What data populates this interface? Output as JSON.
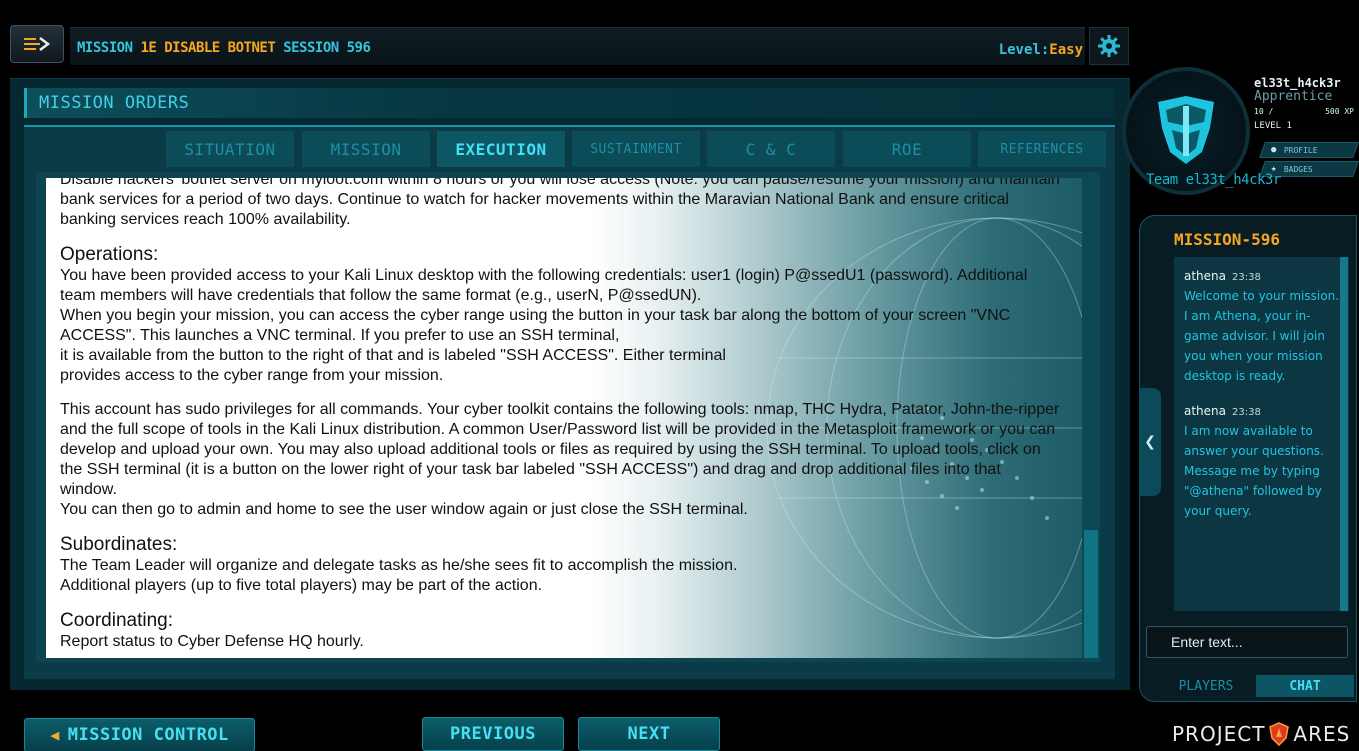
{
  "header": {
    "mission_prefix": "MISSION",
    "mission_id": "1E DISABLE BOTNET",
    "session_label": "SESSION 596",
    "level_label": "Level:",
    "level_value": "Easy"
  },
  "orders": {
    "title": "MISSION ORDERS",
    "tabs": [
      {
        "label": "SITUATION",
        "active": false
      },
      {
        "label": "MISSION",
        "active": false
      },
      {
        "label": "EXECUTION",
        "active": true
      },
      {
        "label": "SUSTAINMENT",
        "active": false
      },
      {
        "label": "C & C",
        "active": false
      },
      {
        "label": "ROE",
        "active": false
      },
      {
        "label": "REFERENCES",
        "active": false
      }
    ],
    "intro": "Disable hackers' botnet server on myloot.com within 8 hours or you will lose access (Note: you can pause/resume your mission) and maintain bank services for a period of two days.  Continue to watch for hacker movements within the Maravian National Bank and ensure critical banking services reach 100% availability.",
    "operations_heading": "Operations:",
    "operations_p1": "You have been provided access to your Kali Linux desktop with the following credentials: user1 (login) P@ssedU1 (password). Additional team members will have credentials that follow the same format (e.g., userN, P@ssedUN).\nWhen you begin your mission, you can access the cyber range using the button in your task bar along the bottom of your screen \"VNC ACCESS\". This launches a VNC terminal. If you prefer to use an SSH terminal,\nit is available from the button to the right of that and is labeled \"SSH ACCESS\". Either terminal\nprovides access to the cyber range from your mission.",
    "operations_p2": "This account has sudo privileges for all commands. Your cyber toolkit contains the following tools: nmap, THC Hydra, Patator, John-the-ripper and the full scope of tools in the Kali Linux distribution.  A common User/Password list will be provided in the Metasploit framework or you can develop and upload your own. You may also upload additional tools or files as required by using the SSH terminal. To upload tools, click on the SSH terminal (it is a button on the lower right of your task bar labeled \"SSH ACCESS\") and drag and drop additional files into that window.\nYou can then go to admin and home to see the user window again or just close the SSH terminal.",
    "subordinates_heading": "Subordinates:",
    "subordinates_p": "The Team Leader will organize and delegate tasks as he/she sees fit to accomplish the mission.\nAdditional players (up to five total players) may be part of the action.",
    "coordinating_heading": "Coordinating:",
    "coordinating_p": "Report status to Cyber Defense HQ hourly."
  },
  "footer": {
    "mission_control": "MISSION CONTROL",
    "previous": "PREVIOUS",
    "next": "NEXT",
    "logo_left": "PROJECT",
    "logo_right": "ARES"
  },
  "profile": {
    "username": "el33t_h4ck3r",
    "rank": "Apprentice",
    "xp_current": "10 /",
    "xp_total": "500 XP",
    "level": "LEVEL 1",
    "profile_button": "PROFILE",
    "badges_button": "BADGES",
    "team": "Team el33t_h4ck3r"
  },
  "chat": {
    "title": "MISSION-596",
    "messages": [
      {
        "sender": "athena",
        "time": "23:38",
        "body": "Welcome to your mission. I am Athena, your in-game advisor. I will join you when your mission desktop is ready."
      },
      {
        "sender": "athena",
        "time": "23:38",
        "body": "I am now available to answer your questions. Message me by typing \"@athena\" followed by your query."
      }
    ],
    "input_placeholder": "Enter text...",
    "tab_players": "PLAYERS",
    "tab_chat": "CHAT"
  },
  "icons": {
    "menu": "menu-arrow-icon",
    "settings": "gear-icon",
    "back": "arrow-left-icon",
    "profile": "person-icon",
    "badges": "star-icon",
    "collapse": "chevron-left-icon",
    "avatar": "robot-helmet-icon",
    "logo": "ares-shield-icon"
  },
  "colors": {
    "accent": "#35c4dc",
    "highlight": "#f5a623",
    "panel": "#062830"
  }
}
